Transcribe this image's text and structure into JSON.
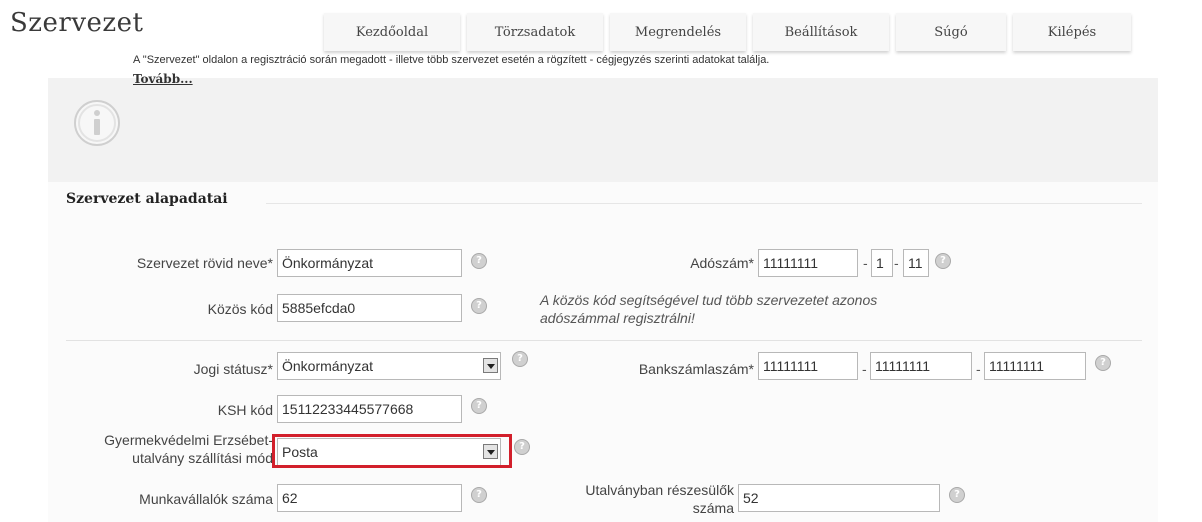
{
  "app_title": "Szervezet",
  "nav": [
    "Kezdőoldal",
    "Törzsadatok",
    "Megrendelés",
    "Beállítások",
    "Súgó",
    "Kilépés"
  ],
  "info": {
    "icon": "info-icon",
    "text": "A \"Szervezet\" oldalon a regisztráció során megadott - illetve több szervezet esetén a rögzített - cégjegyzés szerinti adatokat találja.",
    "more_link": "Tovább..."
  },
  "section": {
    "title": "Szervezet alapadatai",
    "short_name_label": "Szervezet rövid neve*",
    "short_name_value": "Önkormányzat",
    "common_code_label": "Közös kód",
    "common_code_value": "5885efcda0",
    "common_code_note": "A közös kód segítségével tud több szervezetet azonos adószámmal regisztrálni!",
    "tax_label": "Adószám*",
    "tax_1": "11111111",
    "tax_2": "1",
    "tax_3": "11",
    "legal_status_label": "Jogi státusz*",
    "legal_status_value": "Önkormányzat",
    "bank_label": "Bankszámlaszám*",
    "bank_1": "11111111",
    "bank_2": "11111111",
    "bank_3": "11111111",
    "ksh_label": "KSH kód",
    "ksh_value": "15112233445577668",
    "delivery_label_1": "Gyermekvédelmi Erzsébet-",
    "delivery_label_2": "utalvány szállítási mód",
    "delivery_value": "Posta",
    "employees_label": "Munkavállalók száma",
    "employees_value": "62",
    "beneficiaries_label_1": "Utalványban részesülők",
    "beneficiaries_label_2": "száma",
    "beneficiaries_value": "52",
    "dash": "-",
    "help_glyph": "?"
  },
  "colors": {
    "highlight": "#d21f2b",
    "panel": "#f2f2f2"
  }
}
